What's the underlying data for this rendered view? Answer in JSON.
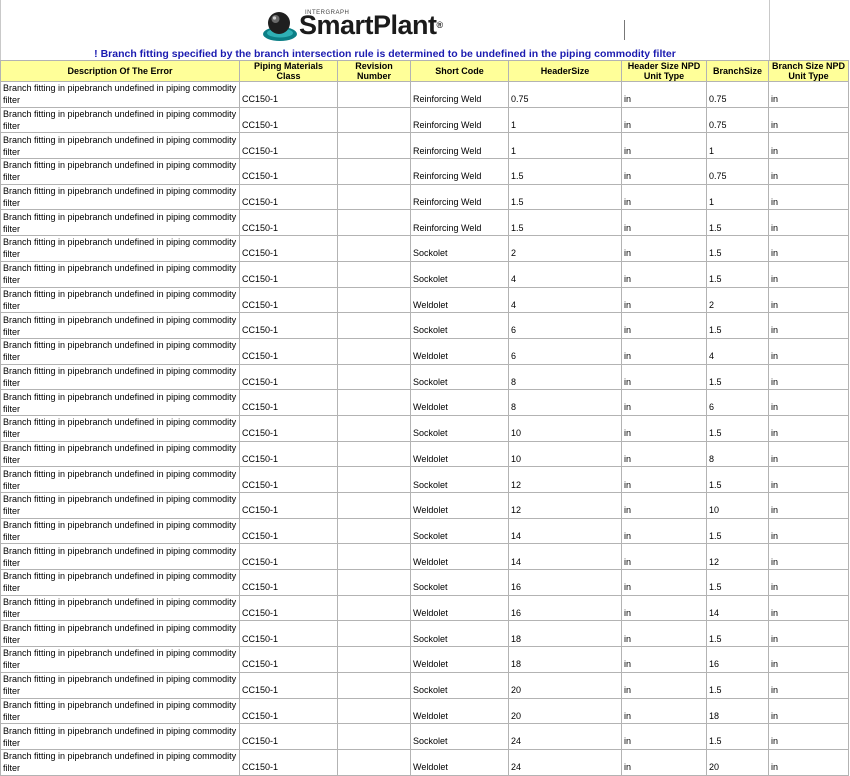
{
  "banner": {
    "logo_text": "SmartPlant",
    "logo_registered": "®",
    "logo_small": "INTERGRAPH",
    "subtitle": "! Branch fitting specified by the branch intersection rule is determined to be undefined in the piping commodity filter"
  },
  "table": {
    "headers": [
      "Description Of The Error",
      "Piping Materials Class",
      "Revision Number",
      "Short Code",
      "HeaderSize",
      "Header Size NPD Unit Type",
      "BranchSize",
      "Branch Size NPD Unit Type"
    ],
    "rows": [
      [
        "Branch fitting in pipebranch undefined in piping commodity filter",
        "CC150-1",
        "",
        "Reinforcing Weld",
        "0.75",
        "in",
        "0.75",
        "in"
      ],
      [
        "Branch fitting in pipebranch undefined in piping commodity filter",
        "CC150-1",
        "",
        "Reinforcing Weld",
        "1",
        "in",
        "0.75",
        "in"
      ],
      [
        "Branch fitting in pipebranch undefined in piping commodity filter",
        "CC150-1",
        "",
        "Reinforcing Weld",
        "1",
        "in",
        "1",
        "in"
      ],
      [
        "Branch fitting in pipebranch undefined in piping commodity filter",
        "CC150-1",
        "",
        "Reinforcing Weld",
        "1.5",
        "in",
        "0.75",
        "in"
      ],
      [
        "Branch fitting in pipebranch undefined in piping commodity filter",
        "CC150-1",
        "",
        "Reinforcing Weld",
        "1.5",
        "in",
        "1",
        "in"
      ],
      [
        "Branch fitting in pipebranch undefined in piping commodity filter",
        "CC150-1",
        "",
        "Reinforcing Weld",
        "1.5",
        "in",
        "1.5",
        "in"
      ],
      [
        "Branch fitting in pipebranch undefined in piping commodity filter",
        "CC150-1",
        "",
        "Sockolet",
        "2",
        "in",
        "1.5",
        "in"
      ],
      [
        "Branch fitting in pipebranch undefined in piping commodity filter",
        "CC150-1",
        "",
        "Sockolet",
        "4",
        "in",
        "1.5",
        "in"
      ],
      [
        "Branch fitting in pipebranch undefined in piping commodity filter",
        "CC150-1",
        "",
        "Weldolet",
        "4",
        "in",
        "2",
        "in"
      ],
      [
        "Branch fitting in pipebranch undefined in piping commodity filter",
        "CC150-1",
        "",
        "Sockolet",
        "6",
        "in",
        "1.5",
        "in"
      ],
      [
        "Branch fitting in pipebranch undefined in piping commodity filter",
        "CC150-1",
        "",
        "Weldolet",
        "6",
        "in",
        "4",
        "in"
      ],
      [
        "Branch fitting in pipebranch undefined in piping commodity filter",
        "CC150-1",
        "",
        "Sockolet",
        "8",
        "in",
        "1.5",
        "in"
      ],
      [
        "Branch fitting in pipebranch undefined in piping commodity filter",
        "CC150-1",
        "",
        "Weldolet",
        "8",
        "in",
        "6",
        "in"
      ],
      [
        "Branch fitting in pipebranch undefined in piping commodity filter",
        "CC150-1",
        "",
        "Sockolet",
        "10",
        "in",
        "1.5",
        "in"
      ],
      [
        "Branch fitting in pipebranch undefined in piping commodity filter",
        "CC150-1",
        "",
        "Weldolet",
        "10",
        "in",
        "8",
        "in"
      ],
      [
        "Branch fitting in pipebranch undefined in piping commodity filter",
        "CC150-1",
        "",
        "Sockolet",
        "12",
        "in",
        "1.5",
        "in"
      ],
      [
        "Branch fitting in pipebranch undefined in piping commodity filter",
        "CC150-1",
        "",
        "Weldolet",
        "12",
        "in",
        "10",
        "in"
      ],
      [
        "Branch fitting in pipebranch undefined in piping commodity filter",
        "CC150-1",
        "",
        "Sockolet",
        "14",
        "in",
        "1.5",
        "in"
      ],
      [
        "Branch fitting in pipebranch undefined in piping commodity filter",
        "CC150-1",
        "",
        "Weldolet",
        "14",
        "in",
        "12",
        "in"
      ],
      [
        "Branch fitting in pipebranch undefined in piping commodity filter",
        "CC150-1",
        "",
        "Sockolet",
        "16",
        "in",
        "1.5",
        "in"
      ],
      [
        "Branch fitting in pipebranch undefined in piping commodity filter",
        "CC150-1",
        "",
        "Weldolet",
        "16",
        "in",
        "14",
        "in"
      ],
      [
        "Branch fitting in pipebranch undefined in piping commodity filter",
        "CC150-1",
        "",
        "Sockolet",
        "18",
        "in",
        "1.5",
        "in"
      ],
      [
        "Branch fitting in pipebranch undefined in piping commodity filter",
        "CC150-1",
        "",
        "Weldolet",
        "18",
        "in",
        "16",
        "in"
      ],
      [
        "Branch fitting in pipebranch undefined in piping commodity filter",
        "CC150-1",
        "",
        "Sockolet",
        "20",
        "in",
        "1.5",
        "in"
      ],
      [
        "Branch fitting in pipebranch undefined in piping commodity filter",
        "CC150-1",
        "",
        "Weldolet",
        "20",
        "in",
        "18",
        "in"
      ],
      [
        "Branch fitting in pipebranch undefined in piping commodity filter",
        "CC150-1",
        "",
        "Sockolet",
        "24",
        "in",
        "1.5",
        "in"
      ],
      [
        "Branch fitting in pipebranch undefined in piping commodity filter",
        "CC150-1",
        "",
        "Weldolet",
        "24",
        "in",
        "20",
        "in"
      ]
    ]
  },
  "colors": {
    "header_bg": "#ffff99",
    "subtitle_text": "#1b1bb0",
    "grid": "#b3b3b3"
  },
  "icons": {
    "logo": "globe-logo-icon"
  }
}
